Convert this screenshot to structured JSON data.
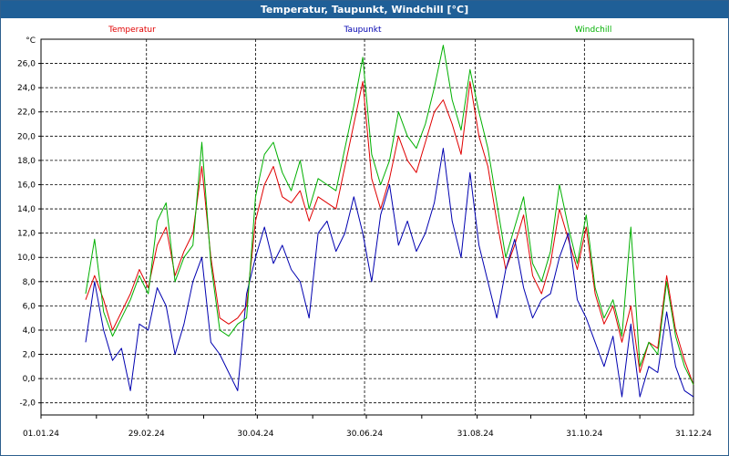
{
  "window": {
    "title": "Temperatur, Taupunkt, Windchill [°C]"
  },
  "chart_data": {
    "type": "line",
    "title": "Temperatur, Taupunkt, Windchill [°C]",
    "ylabel": "°C",
    "xlabel": "",
    "ylim": [
      -3.0,
      28.0
    ],
    "yticks": [
      -2.0,
      0.0,
      2.0,
      4.0,
      6.0,
      8.0,
      10.0,
      12.0,
      14.0,
      16.0,
      18.0,
      20.0,
      22.0,
      24.0,
      26.0
    ],
    "ytick_labels": [
      "-2,0",
      "0,0",
      "2,0",
      "4,0",
      "6,0",
      "8,0",
      "10,0",
      "12,0",
      "14,0",
      "16,0",
      "18,0",
      "20,0",
      "22,0",
      "24,0",
      "26,0"
    ],
    "xlim": [
      "2024-01-01",
      "2024-12-31"
    ],
    "xticks": [
      "2024-01-01",
      "2024-02-29",
      "2024-04-30",
      "2024-06-30",
      "2024-08-31",
      "2024-10-31",
      "2024-12-31"
    ],
    "xtick_labels": [
      "01.01.24",
      "29.02.24",
      "30.04.24",
      "30.06.24",
      "31.08.24",
      "31.10.24",
      "31.12.24"
    ],
    "grid": true,
    "legend_position": "top",
    "series": [
      {
        "name": "Temperatur",
        "color": "#e00000",
        "x": [
          "2024-01-26",
          "2024-01-31",
          "2024-02-05",
          "2024-02-10",
          "2024-02-15",
          "2024-02-20",
          "2024-02-25",
          "2024-03-01",
          "2024-03-06",
          "2024-03-11",
          "2024-03-16",
          "2024-03-21",
          "2024-03-26",
          "2024-03-31",
          "2024-04-05",
          "2024-04-10",
          "2024-04-15",
          "2024-04-20",
          "2024-04-25",
          "2024-04-30",
          "2024-05-05",
          "2024-05-10",
          "2024-05-15",
          "2024-05-20",
          "2024-05-25",
          "2024-05-30",
          "2024-06-04",
          "2024-06-09",
          "2024-06-14",
          "2024-06-19",
          "2024-06-24",
          "2024-06-29",
          "2024-07-04",
          "2024-07-09",
          "2024-07-14",
          "2024-07-19",
          "2024-07-24",
          "2024-07-29",
          "2024-08-03",
          "2024-08-08",
          "2024-08-13",
          "2024-08-18",
          "2024-08-23",
          "2024-08-28",
          "2024-09-02",
          "2024-09-07",
          "2024-09-12",
          "2024-09-17",
          "2024-09-22",
          "2024-09-27",
          "2024-10-02",
          "2024-10-07",
          "2024-10-12",
          "2024-10-17",
          "2024-10-22",
          "2024-10-27",
          "2024-11-01",
          "2024-11-06",
          "2024-11-11",
          "2024-11-16",
          "2024-11-21",
          "2024-11-26",
          "2024-12-01",
          "2024-12-06",
          "2024-12-11",
          "2024-12-16",
          "2024-12-21",
          "2024-12-26",
          "2024-12-31"
        ],
        "values": [
          6.5,
          8.5,
          6.5,
          4.0,
          5.5,
          7.0,
          9.0,
          7.5,
          11.0,
          12.5,
          8.5,
          10.5,
          12.0,
          17.5,
          10.0,
          5.0,
          4.5,
          5.0,
          6.0,
          13.0,
          16.0,
          17.5,
          15.0,
          14.5,
          15.5,
          13.0,
          15.0,
          14.5,
          14.0,
          17.5,
          21.0,
          24.5,
          16.5,
          14.0,
          16.5,
          20.0,
          18.0,
          17.0,
          19.5,
          22.0,
          23.0,
          21.0,
          18.5,
          24.5,
          20.0,
          17.5,
          13.0,
          9.0,
          11.0,
          13.5,
          8.5,
          7.0,
          9.5,
          14.0,
          11.5,
          9.0,
          12.5,
          7.0,
          4.5,
          6.0,
          3.0,
          6.0,
          0.5,
          3.0,
          2.5,
          8.5,
          4.0,
          1.5,
          -0.5
        ]
      },
      {
        "name": "Taupunkt",
        "color": "#0000b0",
        "x": [
          "2024-01-26",
          "2024-01-31",
          "2024-02-05",
          "2024-02-10",
          "2024-02-15",
          "2024-02-20",
          "2024-02-25",
          "2024-03-01",
          "2024-03-06",
          "2024-03-11",
          "2024-03-16",
          "2024-03-21",
          "2024-03-26",
          "2024-03-31",
          "2024-04-05",
          "2024-04-10",
          "2024-04-15",
          "2024-04-20",
          "2024-04-25",
          "2024-04-30",
          "2024-05-05",
          "2024-05-10",
          "2024-05-15",
          "2024-05-20",
          "2024-05-25",
          "2024-05-30",
          "2024-06-04",
          "2024-06-09",
          "2024-06-14",
          "2024-06-19",
          "2024-06-24",
          "2024-06-29",
          "2024-07-04",
          "2024-07-09",
          "2024-07-14",
          "2024-07-19",
          "2024-07-24",
          "2024-07-29",
          "2024-08-03",
          "2024-08-08",
          "2024-08-13",
          "2024-08-18",
          "2024-08-23",
          "2024-08-28",
          "2024-09-02",
          "2024-09-07",
          "2024-09-12",
          "2024-09-17",
          "2024-09-22",
          "2024-09-27",
          "2024-10-02",
          "2024-10-07",
          "2024-10-12",
          "2024-10-17",
          "2024-10-22",
          "2024-10-27",
          "2024-11-01",
          "2024-11-06",
          "2024-11-11",
          "2024-11-16",
          "2024-11-21",
          "2024-11-26",
          "2024-12-01",
          "2024-12-06",
          "2024-12-11",
          "2024-12-16",
          "2024-12-21",
          "2024-12-26",
          "2024-12-31"
        ],
        "values": [
          3.0,
          8.0,
          4.0,
          1.5,
          2.5,
          -1.0,
          4.5,
          4.0,
          7.5,
          6.0,
          2.0,
          4.5,
          8.0,
          10.0,
          3.0,
          2.0,
          0.5,
          -1.0,
          7.0,
          10.0,
          12.5,
          9.5,
          11.0,
          9.0,
          8.0,
          5.0,
          12.0,
          13.0,
          10.5,
          12.0,
          15.0,
          12.0,
          8.0,
          13.5,
          16.0,
          11.0,
          13.0,
          10.5,
          12.0,
          14.5,
          19.0,
          13.0,
          10.0,
          17.0,
          11.0,
          8.0,
          5.0,
          9.0,
          11.5,
          7.5,
          5.0,
          6.5,
          7.0,
          10.0,
          12.0,
          6.5,
          5.0,
          3.0,
          1.0,
          3.5,
          -1.5,
          4.5,
          -1.5,
          1.0,
          0.5,
          5.5,
          1.0,
          -1.0,
          -1.5
        ]
      },
      {
        "name": "Windchill",
        "color": "#00b000",
        "x": [
          "2024-01-26",
          "2024-01-31",
          "2024-02-05",
          "2024-02-10",
          "2024-02-15",
          "2024-02-20",
          "2024-02-25",
          "2024-03-01",
          "2024-03-06",
          "2024-03-11",
          "2024-03-16",
          "2024-03-21",
          "2024-03-26",
          "2024-03-31",
          "2024-04-05",
          "2024-04-10",
          "2024-04-15",
          "2024-04-20",
          "2024-04-25",
          "2024-04-30",
          "2024-05-05",
          "2024-05-10",
          "2024-05-15",
          "2024-05-20",
          "2024-05-25",
          "2024-05-30",
          "2024-06-04",
          "2024-06-09",
          "2024-06-14",
          "2024-06-19",
          "2024-06-24",
          "2024-06-29",
          "2024-07-04",
          "2024-07-09",
          "2024-07-14",
          "2024-07-19",
          "2024-07-24",
          "2024-07-29",
          "2024-08-03",
          "2024-08-08",
          "2024-08-13",
          "2024-08-18",
          "2024-08-23",
          "2024-08-28",
          "2024-09-02",
          "2024-09-07",
          "2024-09-12",
          "2024-09-17",
          "2024-09-22",
          "2024-09-27",
          "2024-10-02",
          "2024-10-07",
          "2024-10-12",
          "2024-10-17",
          "2024-10-22",
          "2024-10-27",
          "2024-11-01",
          "2024-11-06",
          "2024-11-11",
          "2024-11-16",
          "2024-11-21",
          "2024-11-26",
          "2024-12-01",
          "2024-12-06",
          "2024-12-11",
          "2024-12-16",
          "2024-12-21",
          "2024-12-26",
          "2024-12-31"
        ],
        "values": [
          7.0,
          11.5,
          5.5,
          3.5,
          5.0,
          6.5,
          8.5,
          7.0,
          13.0,
          14.5,
          8.0,
          10.0,
          11.0,
          19.5,
          9.5,
          4.0,
          3.5,
          4.5,
          5.0,
          15.0,
          18.5,
          19.5,
          17.0,
          15.5,
          18.0,
          14.0,
          16.5,
          16.0,
          15.5,
          19.0,
          22.5,
          26.5,
          18.5,
          16.0,
          18.0,
          22.0,
          20.0,
          19.0,
          21.0,
          24.0,
          27.5,
          23.0,
          20.5,
          25.5,
          22.0,
          19.0,
          14.5,
          10.0,
          12.5,
          15.0,
          9.5,
          8.0,
          10.5,
          16.0,
          12.5,
          9.5,
          13.5,
          7.5,
          5.0,
          6.5,
          3.5,
          12.5,
          1.0,
          3.0,
          2.0,
          8.0,
          3.5,
          1.0,
          -0.5
        ]
      }
    ]
  }
}
